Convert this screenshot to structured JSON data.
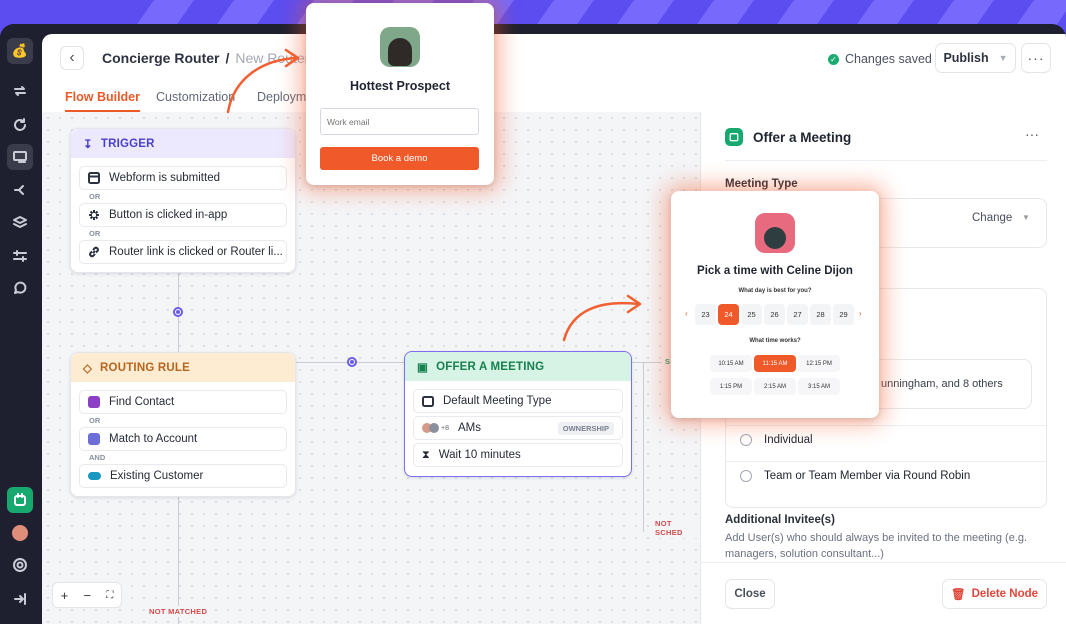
{
  "breadcrumb": {
    "parent": "Concierge Router",
    "separator": "/",
    "current": "New Router"
  },
  "status": {
    "saved": "Changes saved",
    "publish": "Publish",
    "more": "···"
  },
  "tabs": [
    "Flow Builder",
    "Customization",
    "Deployment"
  ],
  "trigger": {
    "title": "TRIGGER",
    "items": [
      "Webform is submitted",
      "Button is clicked in-app",
      "Router link is clicked or Router li..."
    ],
    "or": "OR"
  },
  "routing": {
    "title": "ROUTING RULE",
    "items": [
      "Find Contact",
      "Match to Account",
      "Existing Customer"
    ],
    "joins": [
      "OR",
      "AND"
    ]
  },
  "offer": {
    "title": "OFFER A MEETING",
    "meeting_type": "Default Meeting Type",
    "avatar_more": "+8",
    "ams": "AMs",
    "ownership": "OWNERSHIP",
    "wait": "Wait 10 minutes"
  },
  "tags": {
    "not_matched": "NOT MATCHED",
    "not_sched": "NOT SCHED",
    "side_s": "S"
  },
  "zoom": {
    "in": "+",
    "out": "−",
    "fit": "⛶"
  },
  "panel": {
    "title": "Offer a Meeting",
    "menu": "···",
    "meeting_type_label": "Meeting Type",
    "change": "Change",
    "hosts_text": "unningham, and 8 others",
    "options": [
      "Individual",
      "Team or Team Member via Round Robin"
    ],
    "additional_label": "Additional Invitee(s)",
    "additional_desc": "Add User(s) who should always be invited to the meeting (e.g. managers, solution consultant...)",
    "close": "Close",
    "delete": "Delete Node"
  },
  "prospect_popup": {
    "title": "Hottest Prospect",
    "email_placeholder": "Work email",
    "cta": "Book a demo"
  },
  "scheduler_popup": {
    "title": "Pick a time with Celine Dijon",
    "day_question": "What day is best for you?",
    "days": [
      "23",
      "24",
      "25",
      "26",
      "27",
      "28",
      "29"
    ],
    "selected_day": "24",
    "time_question": "What time works?",
    "times": [
      "10:15 AM",
      "11:15 AM",
      "12:15 PM",
      "1:15 PM",
      "2:15 AM",
      "3:15 AM"
    ],
    "selected_time": "11:15 AM"
  },
  "colors": {
    "accent": "#ec5a2a",
    "brand_purple": "#5b4be8",
    "success": "#16a86f"
  }
}
